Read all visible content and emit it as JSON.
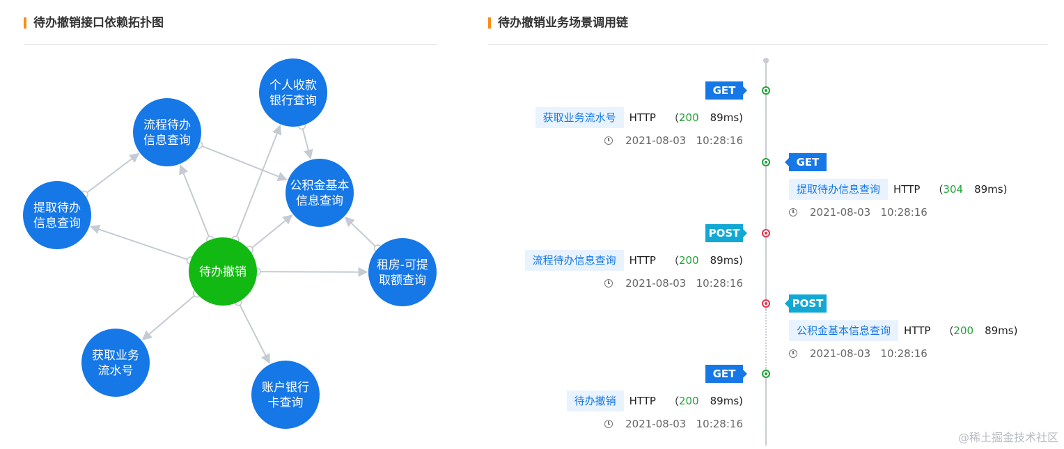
{
  "left_panel": {
    "title": "待办撤销接口依赖拓扑图"
  },
  "right_panel": {
    "title": "待办撤销业务场景调用链"
  },
  "topology": {
    "nodes": [
      {
        "id": "center",
        "lines": [
          "待办撤销"
        ],
        "color": "#13b913"
      },
      {
        "id": "n1",
        "lines": [
          "个人收款",
          "银行查询"
        ],
        "color": "#1677e6"
      },
      {
        "id": "n2",
        "lines": [
          "流程待办",
          "信息查询"
        ],
        "color": "#1677e6"
      },
      {
        "id": "n3",
        "lines": [
          "提取待办",
          "信息查询"
        ],
        "color": "#1677e6"
      },
      {
        "id": "n4",
        "lines": [
          "公积金基本",
          "信息查询"
        ],
        "color": "#1677e6"
      },
      {
        "id": "n5",
        "lines": [
          "租房-可提",
          "取额查询"
        ],
        "color": "#1677e6"
      },
      {
        "id": "n6",
        "lines": [
          "获取业务",
          "流水号"
        ],
        "color": "#1677e6"
      },
      {
        "id": "n7",
        "lines": [
          "账户银行",
          "卡查询"
        ],
        "color": "#1677e6"
      }
    ]
  },
  "timeline": {
    "calls": [
      {
        "method": "GET",
        "name": "获取业务流水号",
        "protocol": "HTTP",
        "code": "200",
        "duration": "89ms",
        "time": "2021-08-03   10:28:16",
        "status_color": "#21a336"
      },
      {
        "method": "GET",
        "name": "提取待办信息查询",
        "protocol": "HTTP",
        "code": "304",
        "duration": "89ms",
        "time": "2021-08-03   10:28:16",
        "status_color": "#21a336"
      },
      {
        "method": "POST",
        "name": "流程待办信息查询",
        "protocol": "HTTP",
        "code": "200",
        "duration": "89ms",
        "time": "2021-08-03   10:28:16",
        "status_color": "#e8334a"
      },
      {
        "method": "POST",
        "name": "公积金基本信息查询",
        "protocol": "HTTP",
        "code": "200",
        "duration": "89ms",
        "time": "2021-08-03   10:28:16",
        "status_color": "#e8334a"
      },
      {
        "method": "GET",
        "name": "待办撤销",
        "protocol": "HTTP",
        "code": "200",
        "duration": "89ms",
        "time": "2021-08-03   10:28:16",
        "status_color": "#21a336"
      }
    ]
  },
  "watermark": "@稀土掘金技术社区"
}
